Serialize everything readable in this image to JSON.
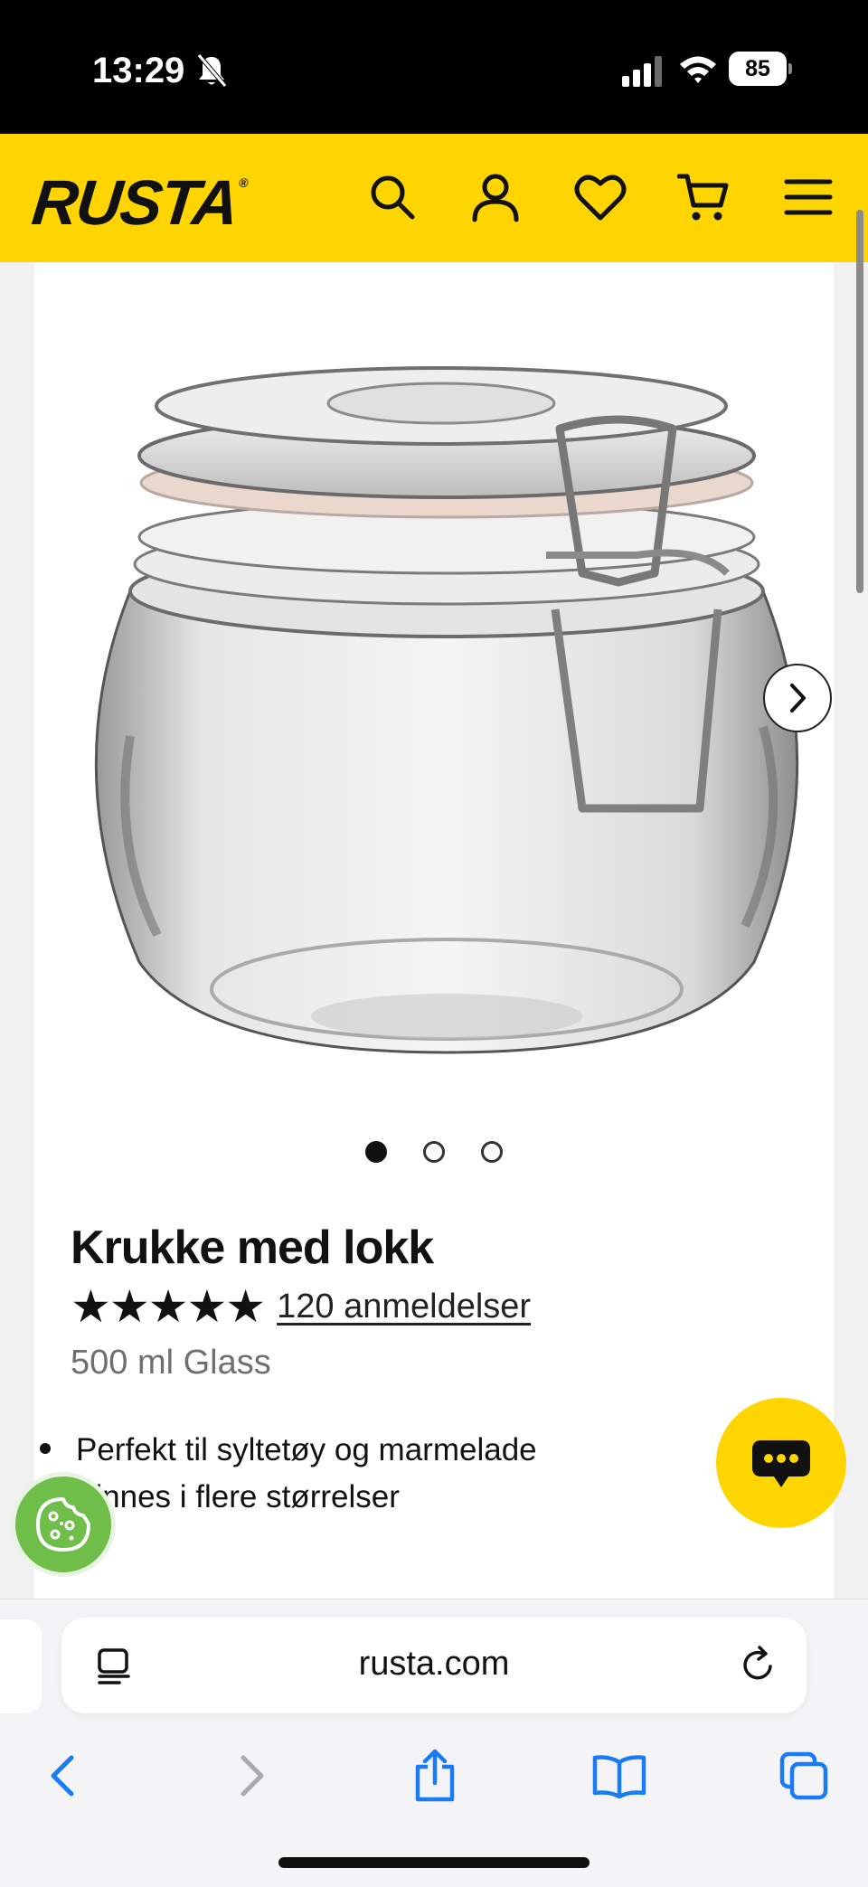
{
  "status_bar": {
    "time": "13:29",
    "battery": "85"
  },
  "header": {
    "logo": "RUSTA",
    "logo_mark": "®",
    "icons": [
      "search-icon",
      "account-icon",
      "heart-icon",
      "cart-icon",
      "menu-icon"
    ]
  },
  "product": {
    "title": "Krukke med lokk",
    "stars": "★★★★★",
    "rating_value": 5,
    "reviews": "120 anmeldelser",
    "variant": "500 ml Glass",
    "image_count": 3,
    "active_image": 1,
    "bullets": [
      "Perfekt til syltetøy og marmelade",
      "Finnes i flere størrelser"
    ]
  },
  "browser": {
    "url": "rusta.com"
  },
  "colors": {
    "brand_yellow": "#ffd500",
    "cookie_green": "#6fbe4a",
    "safari_blue": "#1a7cf5"
  }
}
